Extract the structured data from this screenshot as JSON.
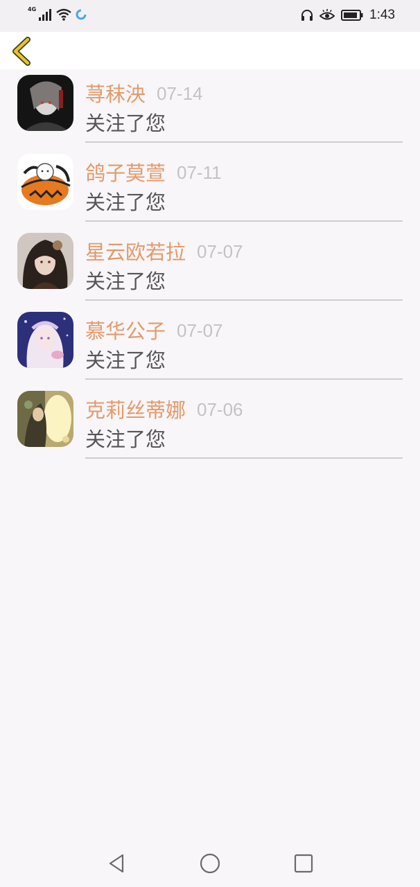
{
  "status_bar": {
    "network": "4G",
    "time": "1:43",
    "icons": [
      "signal-icon",
      "wifi-icon",
      "loading-icon",
      "headphones-icon",
      "eye-comfort-icon",
      "battery-icon"
    ]
  },
  "header": {
    "back_icon": "chevron-left-icon"
  },
  "notifications": [
    {
      "name": "荨秣泱",
      "date": "07-14",
      "message": "关注了您"
    },
    {
      "name": "鸽子莫萱",
      "date": "07-11",
      "message": "关注了您"
    },
    {
      "name": "星云欧若拉",
      "date": "07-07",
      "message": "关注了您"
    },
    {
      "name": "慕华公子",
      "date": "07-07",
      "message": "关注了您"
    },
    {
      "name": "克莉丝蒂娜",
      "date": "07-06",
      "message": "关注了您"
    }
  ],
  "nav_bar": {
    "icons": [
      "back-triangle-icon",
      "home-circle-icon",
      "recents-square-icon"
    ]
  },
  "colors": {
    "name": "#e39a6b",
    "date": "#c4c2c4",
    "message": "#555555",
    "accent_back": "#e8c32a"
  }
}
